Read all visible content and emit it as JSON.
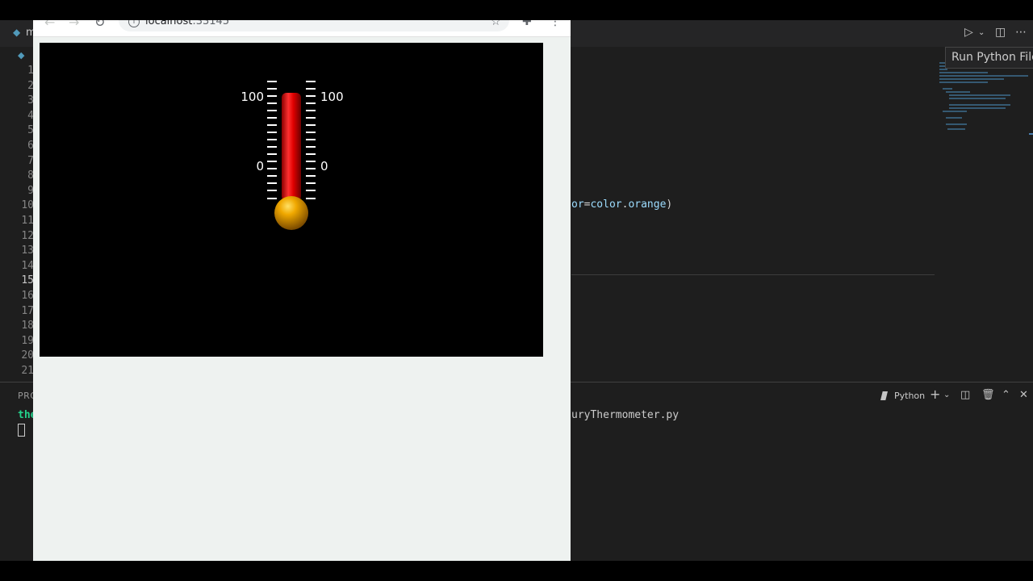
{
  "browser": {
    "url_host": "localhost",
    "url_port": ":33145"
  },
  "thermometer": {
    "max_label": "100",
    "zero_label": "0",
    "mercury_color": "#e00000",
    "bulb_color": "#e8a000",
    "tick_color": "#ffffff"
  },
  "editor": {
    "tab_initial": "m",
    "line_numbers": [
      "1",
      "2",
      "3",
      "4",
      "5",
      "6",
      "7",
      "8",
      "9",
      "10",
      "11",
      "12",
      "13",
      "14",
      "15",
      "16",
      "17",
      "18",
      "19",
      "20",
      "21"
    ],
    "current_line": "15",
    "code_fragment": {
      "prefix": "or",
      "op": "=",
      "ident": "color",
      "dot": ".",
      "attr": "orange",
      "suffix": ")"
    },
    "tooltip": "Run Python File"
  },
  "panel": {
    "tab_label": "PRO",
    "terminal_prompt": "the",
    "terminal_line": "uryThermometer.py",
    "shell_name": "Python"
  },
  "icons": {
    "back": "back-arrow-icon",
    "forward": "forward-arrow-icon",
    "reload": "reload-icon",
    "info": "info-icon",
    "star": "star-icon",
    "extensions": "puzzle-icon",
    "menu": "kebab-menu-icon",
    "run": "play-icon",
    "split": "split-editor-icon",
    "more": "ellipsis-icon",
    "add": "plus-icon",
    "trash": "trash-icon",
    "maximize": "chevron-up-icon",
    "close": "close-icon"
  },
  "colors": {
    "vscode_bg": "#1e1e1e",
    "terminal_green": "#23d18b",
    "browser_bg": "#eef2f0"
  }
}
